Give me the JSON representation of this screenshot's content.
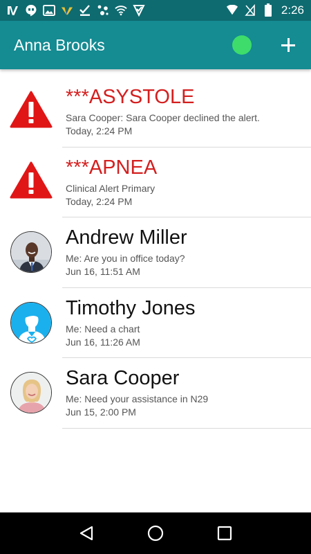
{
  "status_bar": {
    "time": "2:26",
    "left_icons": [
      "iv-app-icon",
      "hangouts-icon",
      "image-icon",
      "vocera-icon",
      "check-download-icon",
      "dots-app-icon",
      "wifi-icon",
      "vpn-check-icon"
    ],
    "right_icons": [
      "signal-icon",
      "no-sim-icon",
      "battery-icon"
    ]
  },
  "header": {
    "title": "Anna Brooks",
    "presence_color": "#3ddc6b",
    "add_icon": "plus-icon"
  },
  "colors": {
    "status_bar": "#0e6b70",
    "app_bar": "#158b92",
    "alert_red": "#d41f1f"
  },
  "conversations": [
    {
      "title": "***ASYSTOLE",
      "subtitle": "Sara Cooper: Sara Cooper declined the alert.",
      "time": "Today, 2:24 PM",
      "type": "alert",
      "icon": "warning-triangle-icon"
    },
    {
      "title": "***APNEA",
      "subtitle": "Clinical Alert Primary",
      "time": "Today, 2:24 PM",
      "type": "alert",
      "icon": "warning-triangle-icon"
    },
    {
      "title": "Andrew Miller",
      "subtitle": "Me: Are you in office today?",
      "time": "Jun 16, 11:51 AM",
      "type": "contact",
      "icon": "avatar-andrew"
    },
    {
      "title": "Timothy Jones",
      "subtitle": "Me: Need a chart",
      "time": "Jun 16, 11:26 AM",
      "type": "contact",
      "icon": "avatar-placeholder-icon"
    },
    {
      "title": "Sara Cooper",
      "subtitle": "Me: Need your assistance in N29",
      "time": "Jun 15, 2:00 PM",
      "type": "contact",
      "icon": "avatar-sara"
    }
  ],
  "nav": {
    "back_icon": "back-triangle-icon",
    "home_icon": "home-circle-icon",
    "recents_icon": "recents-square-icon"
  }
}
